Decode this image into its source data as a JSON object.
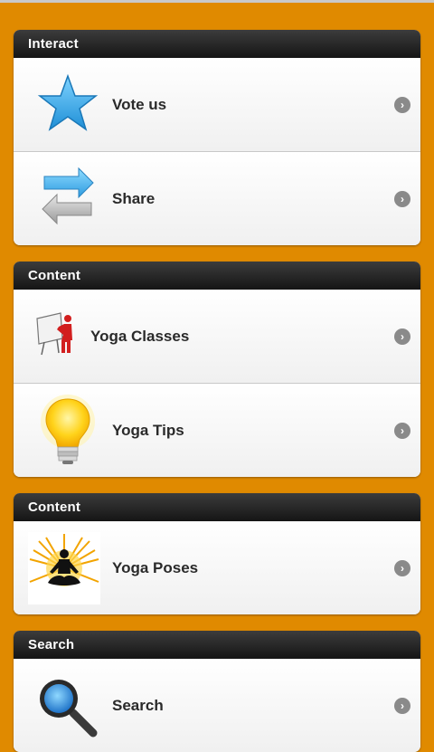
{
  "sections": [
    {
      "title": "Interact",
      "items": [
        {
          "label": "Vote us",
          "icon": "star-icon"
        },
        {
          "label": "Share",
          "icon": "share-arrows-icon"
        }
      ]
    },
    {
      "title": "Content",
      "items": [
        {
          "label": "Yoga Classes",
          "icon": "presentation-board-icon"
        },
        {
          "label": "Yoga Tips",
          "icon": "lightbulb-icon"
        }
      ]
    },
    {
      "title": "Content",
      "items": [
        {
          "label": "Yoga Poses",
          "icon": "meditation-figure-icon"
        }
      ]
    },
    {
      "title": "Search",
      "items": [
        {
          "label": "Search",
          "icon": "magnifier-icon"
        }
      ]
    }
  ],
  "colors": {
    "background": "#e08a00",
    "header": "#1f1f1f",
    "chevron": "#8a8a8a"
  }
}
